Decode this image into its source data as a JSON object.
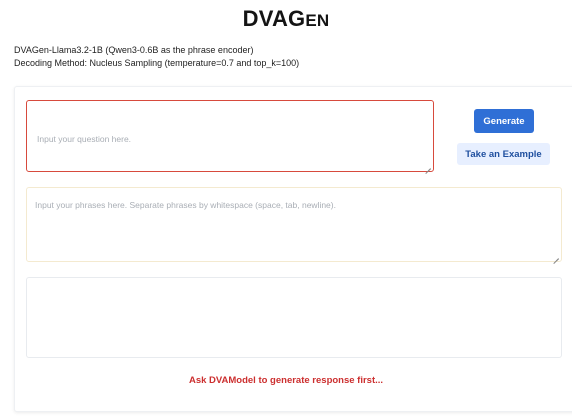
{
  "header": {
    "title_main": "DVAG",
    "title_smallcaps": "EN"
  },
  "info": {
    "model_line": "DVAGen-Llama3.2-1B (Qwen3-0.6B as the phrase encoder)",
    "decoding_line": "Decoding Method: Nucleus Sampling (temperature=0.7 and top_k=100)"
  },
  "form": {
    "question_placeholder": "Input your question here.",
    "phrases_placeholder": "Input your phrases here. Separate phrases by whitespace (space, tab, newline).",
    "generate_label": "Generate",
    "example_label": "Take an Example",
    "status_message": "Ask DVAModel to generate response first..."
  },
  "colors": {
    "primary": "#2f6fd6",
    "secondary_bg": "#e7efff",
    "error_border": "#d74a3d",
    "status_text": "#cc2f2f"
  }
}
